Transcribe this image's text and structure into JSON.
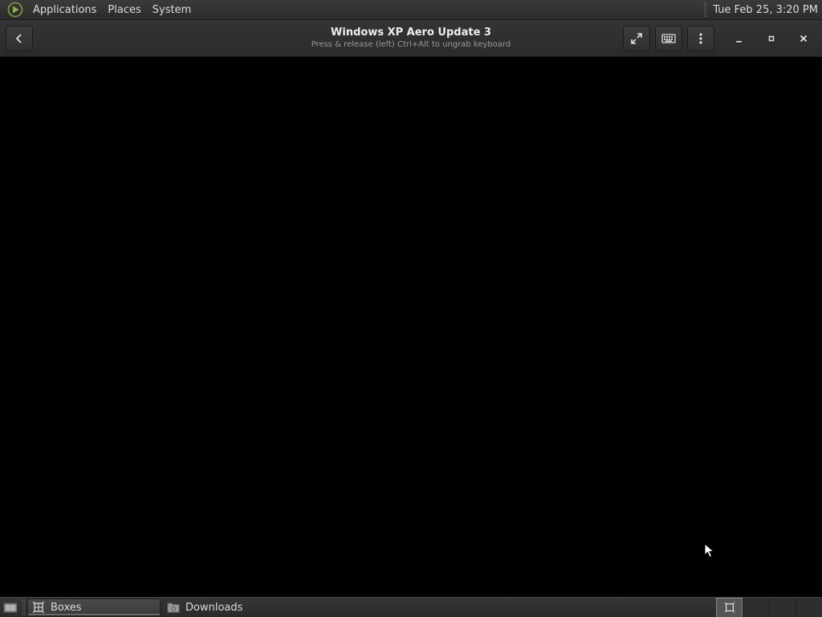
{
  "top_panel": {
    "menus": [
      "Applications",
      "Places",
      "System"
    ],
    "clock": "Tue Feb 25,  3:20 PM"
  },
  "headerbar": {
    "title": "Windows XP Aero Update 3",
    "subtitle": "Press & release (left) Ctrl+Alt to ungrab keyboard",
    "icons": [
      "back-icon",
      "fullscreen-icon",
      "keyboard-icon",
      "menu-icon",
      "minimize-icon",
      "maximize-icon",
      "close-icon"
    ]
  },
  "taskbar": {
    "tasks": [
      {
        "label": "Boxes",
        "icon": "boxes-icon",
        "active": true
      },
      {
        "label": "Downloads",
        "icon": "folder-icon",
        "active": false
      }
    ],
    "workspace_count": 4,
    "active_workspace": 1
  },
  "colors": {
    "panel": "#2c2c2c",
    "headerbar": "#2f2f2f",
    "display": "#000000",
    "accent": "#7c9a3a"
  }
}
